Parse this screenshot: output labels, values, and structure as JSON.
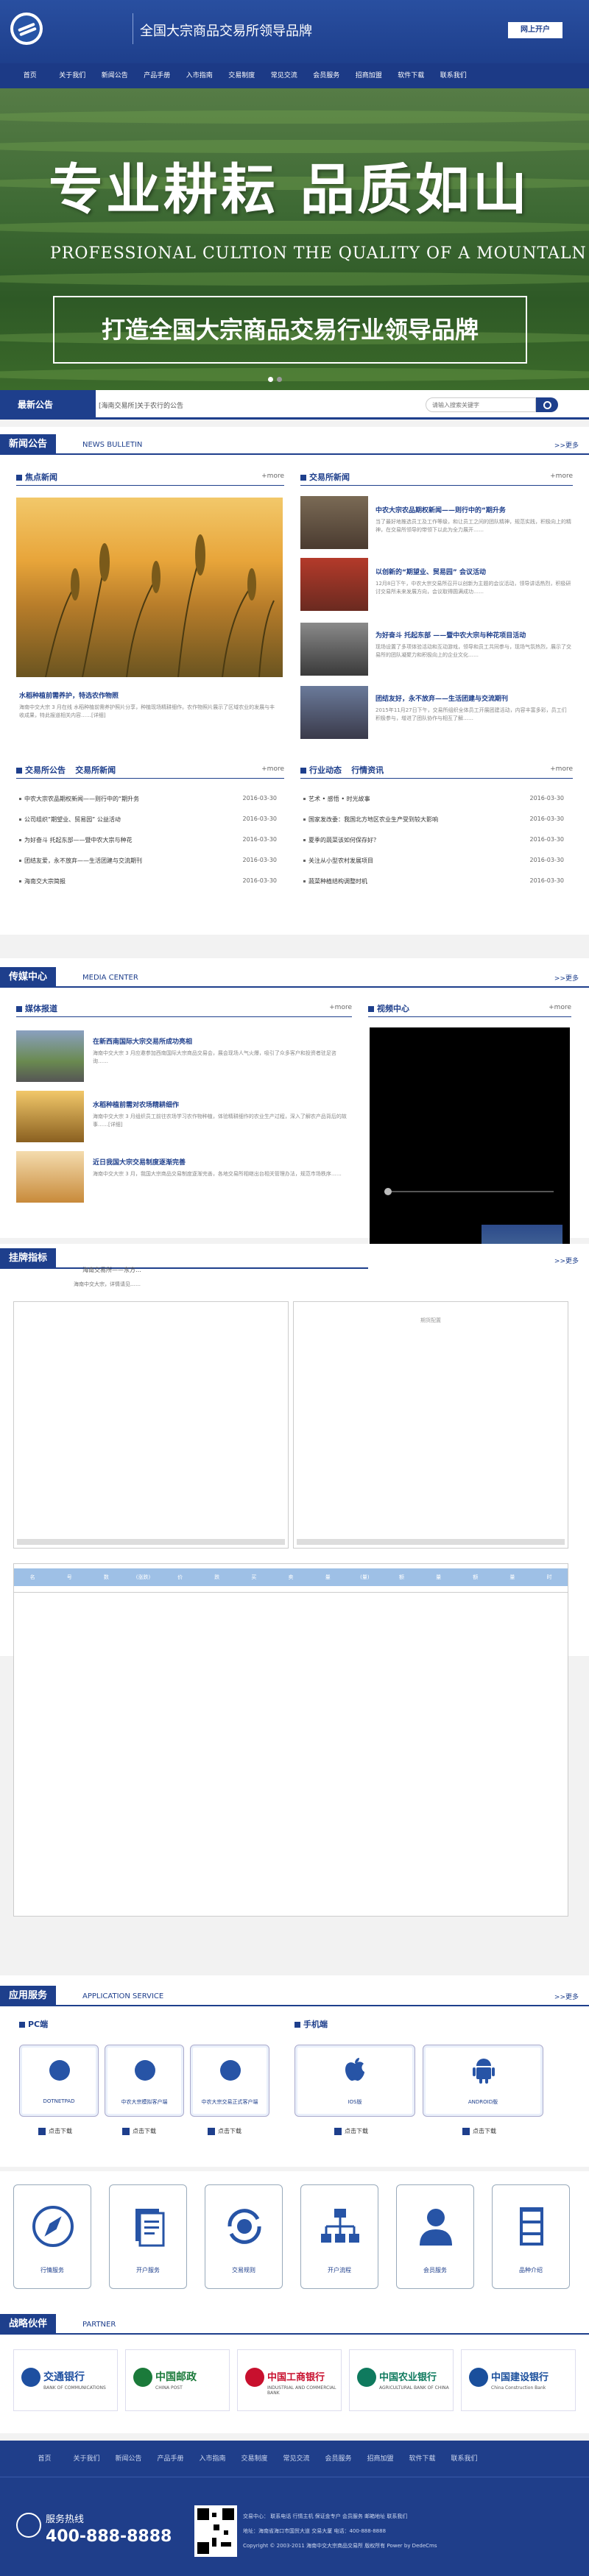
{
  "header": {
    "title": "全国大宗商品交易所领导品牌",
    "login": "网上开户"
  },
  "nav": [
    "首页",
    "关于我们",
    "新闻公告",
    "产品手册",
    "入市指南",
    "交易制度",
    "常见交流",
    "会员服务",
    "招商加盟",
    "软件下载",
    "联系我们"
  ],
  "banner": {
    "slogan_cn": "专业耕耘 品质如山",
    "slogan_en": "PROFESSIONAL CULTION THE QUALITY OF A MOUNTALN",
    "box_text": "打造全国大宗商品交易行业领导品牌"
  },
  "announce": {
    "tab": "最新公告",
    "text": "[海南交易所]关于农行的公告",
    "search_placeholder": "请输入搜索关键字"
  },
  "news": {
    "title": "新闻公告",
    "en": "NEWS BULLETIN",
    "more": ">>更多",
    "focus": {
      "title": "焦点新闻",
      "more": "+more",
      "caption": "水稻种植前需养护，特选农作物照",
      "desc": "海南中交大宗 3 月在线 水稻种植前需养护照片分享，种植现场精耕细作。农作物照片展示了区域农业的发展与丰收成果，特此报道相关内容……[详细]"
    },
    "exchange": {
      "title": "交易所新闻",
      "more": "+more",
      "items": [
        {
          "title": "中农大宗农品期权新闻——则行中的“期升务",
          "desc": "当了最好地推选员工及工作等级，和让员工之间的团队精神，规范实践，积极向上的精神，在交易所领导的带领下以此为全力展开……"
        },
        {
          "title": "以创新的“期望业、贸易园” 会议活动",
          "desc": "12月8日下午，中农大宗交易所召开以创新为主题的会议活动，领导讲话热烈，积极研讨交易所未来发展方向，会议取得圆满成功……"
        },
        {
          "title": "为好奋斗 托起东部 ——暨中农大宗与种花项目活动",
          "desc": "现场设置了多项体验活动和互动游戏，领导和员工共同参与，现场气氛热烈，展示了交易所的团队凝聚力和积极向上的企业文化……"
        },
        {
          "title": "团结友好，永不放弃——生活团建与交流期刊",
          "desc": "2015年11月27日下午，交易所组织全体员工开展团建活动，内容丰富多彩，员工们积极参与，增进了团队协作与相互了解……"
        }
      ]
    },
    "bulletin": {
      "tab1": "交易所公告",
      "tab2": "交易所新闻",
      "more": "+more",
      "rows": [
        {
          "t": "中农大宗农品期权新闻——则行中的“期升务",
          "d": "2016-03-30"
        },
        {
          "t": "公司组织“期望业、贸易园” 公益活动",
          "d": "2016-03-30"
        },
        {
          "t": "为好奋斗 托起东部——暨中农大宗与种花",
          "d": "2016-03-30"
        },
        {
          "t": "团结友爱，永不放弃——生活团建与交流期刊",
          "d": "2016-03-30"
        },
        {
          "t": "海南交大宗简报",
          "d": "2016-03-30"
        }
      ]
    },
    "industry": {
      "tab1": "行业动态",
      "tab2": "行情资讯",
      "more": "+more",
      "rows": [
        {
          "t": "艺术 • 感悟 • 时光故事",
          "d": "2016-03-30"
        },
        {
          "t": "国家发改委：我国北方地区农业生产受到较大影响",
          "d": "2016-03-30"
        },
        {
          "t": "夏季的蔬菜该如何保存好？",
          "d": "2016-03-30"
        },
        {
          "t": "关注从小型农村发展项目",
          "d": "2016-03-30"
        },
        {
          "t": "蔬菜种植结构调整时机",
          "d": "2016-03-30"
        }
      ]
    }
  },
  "media": {
    "title": "传媒中心",
    "en": "MEDIA CENTER",
    "more": ">>更多",
    "report": {
      "title": "媒体报道",
      "more": "+more",
      "items": [
        {
          "title": "在新西南国际大宗交易所成功亮相",
          "desc": "海南中交大宗 3 月应邀参加西南国际大宗商品交易会，展会现场人气火爆，吸引了众多客户和投资者驻足咨询……"
        },
        {
          "title": "水稻种植前需对农场精耕细作",
          "desc": "海南中交大宗 3 月组织员工前往农场学习农作物种植，体验精耕细作的农业生产过程，深入了解农产品背后的故事……[详细]"
        },
        {
          "title": "近日我国大宗交易制度逐渐完善",
          "desc": "海南中交大宗 3 月，我国大宗商品交易制度逐渐完善，各地交易所相继出台相关管理办法，规范市场秩序……"
        }
      ]
    },
    "video": {
      "title": "视频中心",
      "more": "+more"
    }
  },
  "market": {
    "title": "挂牌指标",
    "more": ">>更多",
    "sub": "海南交易所——东方…",
    "caption": "期货配置",
    "ticker": "海南中交大宗，详情请见……",
    "table_headers": [
      "名",
      "号",
      "数",
      "(涨跌)",
      "价",
      "跌",
      "买",
      "卖",
      "量",
      "(量)",
      "额",
      "量",
      "额",
      "量",
      "时"
    ]
  },
  "apps": {
    "title": "应用服务",
    "en": "APPLICATION SERVICE",
    "more": ">>更多",
    "pc": {
      "title": "PC端",
      "items": [
        "DOTNETPAD",
        "中农大宗模拟客户端",
        "中农大宗交易正式客户端"
      ],
      "dl": "点击下载"
    },
    "mobile": {
      "title": "手机端",
      "items": [
        "IOS版",
        "ANDROID版"
      ],
      "dl": "点击下载"
    }
  },
  "services": [
    "行情服务",
    "开户服务",
    "交易规则",
    "开户流程",
    "会员服务",
    "品种介绍"
  ],
  "partners": {
    "title": "战略伙伴",
    "en": "PARTNER",
    "banks": [
      {
        "cn": "交通银行",
        "en": "BANK OF COMMUNICATIONS",
        "color": "#1e4fa0"
      },
      {
        "cn": "中国邮政",
        "en": "CHINA POST",
        "color": "#1b7a3a"
      },
      {
        "cn": "中国工商银行",
        "en": "INDUSTRIAL AND COMMERCIAL BANK",
        "color": "#c8102e"
      },
      {
        "cn": "中国农业银行",
        "en": "AGRICULTURAL BANK OF CHINA",
        "color": "#0f7a5e"
      },
      {
        "cn": "中国建设银行",
        "en": "China Construction Bank",
        "color": "#1a4f9c"
      }
    ]
  },
  "footer": {
    "nav": [
      "首页",
      "关于我们",
      "新闻公告",
      "产品手册",
      "入市指南",
      "交易制度",
      "常见交流",
      "会员服务",
      "招商加盟",
      "软件下载",
      "联系我们"
    ],
    "hotline_label": "服务热线",
    "hotline": "400-888-8888",
    "lines": [
      "交易中心：  联系电话  行情主机  保证金专户  会员服务  邮箱地址  联系我们",
      "地址：海南省海口市国贸大道 交易大厦 电话：400-888-8888",
      "Copyright © 2003-2011 海南中交大宗商品交易所 版权所有 Power by DedeCms"
    ]
  },
  "colors": {
    "primary": "#1e3f8c",
    "accent": "#2754a6"
  }
}
